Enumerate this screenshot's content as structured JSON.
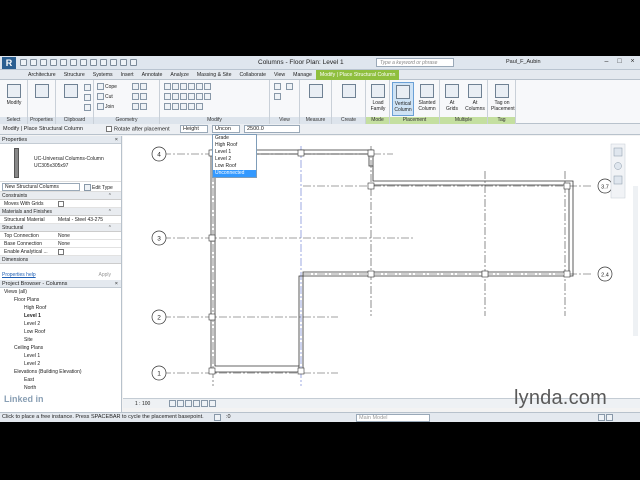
{
  "titlebar": {
    "app_logo": "R",
    "window_title": "Columns - Floor Plan: Level 1",
    "search_placeholder": "Type a keyword or phrase",
    "user": "Paul_F_Aubin"
  },
  "tabs": [
    "Architecture",
    "Structure",
    "Systems",
    "Insert",
    "Annotate",
    "Analyze",
    "Massing & Site",
    "Collaborate",
    "View",
    "Manage",
    "Modify | Place Structural Column"
  ],
  "ribbon": {
    "panels": {
      "select": "Select",
      "properties": "Properties",
      "clipboard": "Clipboard",
      "geometry": "Geometry",
      "modify": "Modify",
      "view": "View",
      "measure": "Measure",
      "create": "Create",
      "mode": "Mode",
      "placement": "Placement",
      "multiple": "Multiple",
      "tag": "Tag"
    },
    "buttons": {
      "modify": "Modify",
      "cope": "Cope",
      "cut": "Cut",
      "join": "Join",
      "load_family_1": "Load",
      "load_family_2": "Family",
      "vertical_column_1": "Vertical",
      "vertical_column_2": "Column",
      "slanted_column_1": "Slanted",
      "slanted_column_2": "Column",
      "at_grids_1": "At",
      "at_grids_2": "Grids",
      "at_columns_1": "At",
      "at_columns_2": "Columns",
      "tag_on_placement_1": "Tag on",
      "tag_on_placement_2": "Placement"
    }
  },
  "options_bar": {
    "context": "Modify | Place Structural Column",
    "rotate_after_placement": "Rotate after placement",
    "height_mode": "Height",
    "level_value": "Uncon",
    "height_value": "2500.0"
  },
  "level_dropdown": {
    "options": [
      "Grade",
      "High Roof",
      "Level 1",
      "Level 2",
      "Low Roof",
      "Unconnected"
    ],
    "selected": "Unconnected"
  },
  "properties": {
    "header": "Properties",
    "type_line1": "UC-Universal Columns-Column",
    "type_line2": "UC305x305x97",
    "instance_filter": "New Structural Columns",
    "edit_type": "Edit Type",
    "groups": [
      {
        "name": "Constraints",
        "rows": [
          {
            "k": "Moves With Grids",
            "v": "checked"
          }
        ]
      },
      {
        "name": "Materials and Finishes",
        "rows": [
          {
            "k": "Structural Material",
            "v": "Metal - Steel 43-275"
          }
        ]
      },
      {
        "name": "Structural",
        "rows": [
          {
            "k": "Top Connection",
            "v": "None"
          },
          {
            "k": "Base Connection",
            "v": "None"
          },
          {
            "k": "Enable Analytical ...",
            "v": "checked"
          }
        ]
      },
      {
        "name": "Dimensions",
        "rows": []
      }
    ],
    "help_link": "Properties help",
    "apply": "Apply"
  },
  "project_browser": {
    "header": "Project Browser - Columns",
    "items": [
      {
        "label": "Views (all)",
        "level": 0,
        "bold": false
      },
      {
        "label": "Floor Plans",
        "level": 1,
        "bold": false
      },
      {
        "label": "High Roof",
        "level": 2,
        "bold": false
      },
      {
        "label": "Level 1",
        "level": 2,
        "bold": true
      },
      {
        "label": "Level 2",
        "level": 2,
        "bold": false
      },
      {
        "label": "Low Roof",
        "level": 2,
        "bold": false
      },
      {
        "label": "Site",
        "level": 2,
        "bold": false
      },
      {
        "label": "Ceiling Plans",
        "level": 1,
        "bold": false
      },
      {
        "label": "Level 1",
        "level": 2,
        "bold": false
      },
      {
        "label": "Level 2",
        "level": 2,
        "bold": false
      },
      {
        "label": "Elevations (Building Elevation)",
        "level": 1,
        "bold": false
      },
      {
        "label": "East",
        "level": 2,
        "bold": false
      },
      {
        "label": "North",
        "level": 2,
        "bold": false
      }
    ]
  },
  "canvas": {
    "grid_labels": [
      "4",
      "3",
      "2",
      "1",
      "3.7",
      "2.4"
    ]
  },
  "view_control": {
    "scale": "1 : 100"
  },
  "status": {
    "message": "Click to place a free instance. Press SPACEBAR to cycle the placement basepoint.",
    "zoom": ":0",
    "model": "Main Model"
  },
  "watermarks": {
    "linkedin": "Linked in",
    "lynda": "lynda.com"
  }
}
